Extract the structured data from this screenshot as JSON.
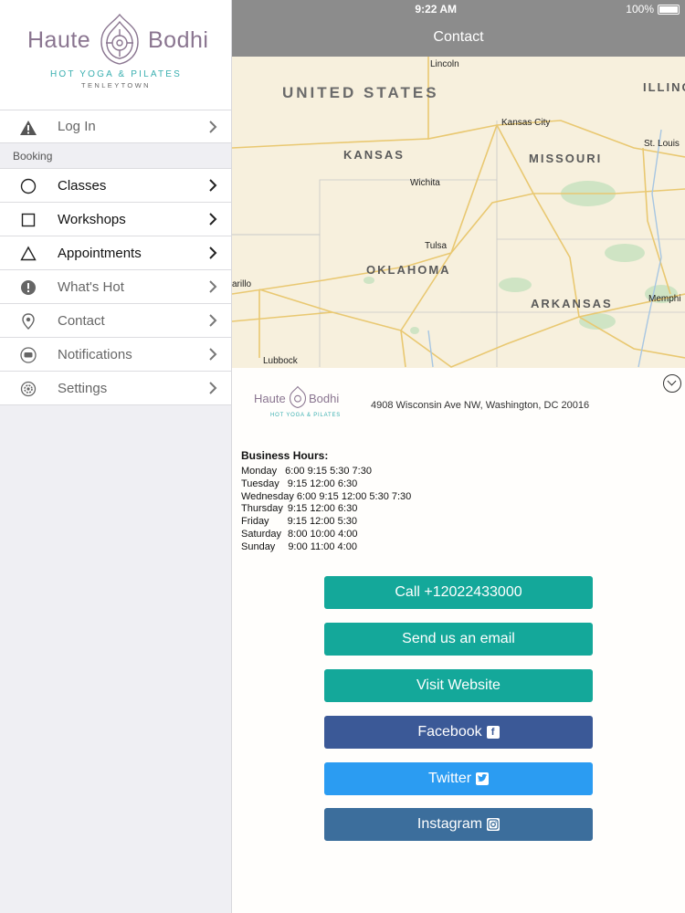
{
  "status_bar": {
    "time": "9:22 AM",
    "battery": "100%"
  },
  "nav": {
    "title": "Contact"
  },
  "logo": {
    "left_word": "Haute",
    "right_word": "Bodhi",
    "tagline": "HOT YOGA & PILATES",
    "location": "TENLEYTOWN"
  },
  "sidebar": {
    "login_label": "Log In",
    "section_label": "Booking",
    "items": [
      {
        "label": "Classes",
        "icon": "circle-icon"
      },
      {
        "label": "Workshops",
        "icon": "square-icon"
      },
      {
        "label": "Appointments",
        "icon": "triangle-icon"
      },
      {
        "label": "What's Hot",
        "icon": "exclamation-icon"
      },
      {
        "label": "Contact",
        "icon": "location-pin-icon"
      },
      {
        "label": "Notifications",
        "icon": "chat-bubble-icon"
      },
      {
        "label": "Settings",
        "icon": "gear-icon"
      }
    ]
  },
  "map": {
    "regions": [
      "UNITED STATES",
      "KANSAS",
      "MISSOURI",
      "OKLAHOMA",
      "ARKANSAS",
      "ILLING"
    ],
    "cities": [
      "Lincoln",
      "Kansas City",
      "St. Louis",
      "Wichita",
      "Tulsa",
      "arillo",
      "Memphi",
      "Lubbock"
    ]
  },
  "contact": {
    "address": "4908 Wisconsin Ave NW, Washington, DC  20016",
    "hours_title": "Business Hours:",
    "hours": [
      {
        "day": "Monday",
        "times": "6:00 9:15 5:30 7:30"
      },
      {
        "day": "Tuesday",
        "times": "9:15 12:00 6:30"
      },
      {
        "day": "Wednesday",
        "times": "6:00 9:15 12:00 5:30 7:30"
      },
      {
        "day": "Thursday",
        "times": "9:15 12:00 6:30"
      },
      {
        "day": "Friday",
        "times": "9:15 12:00 5:30"
      },
      {
        "day": "Saturday",
        "times": "8:00 10:00 4:00"
      },
      {
        "day": "Sunday",
        "times": "9:00 11:00 4:00"
      }
    ],
    "buttons": {
      "call": "Call +12022433000",
      "email": "Send us an email",
      "website": "Visit Website",
      "facebook": "Facebook",
      "twitter": "Twitter",
      "instagram": "Instagram"
    }
  },
  "colors": {
    "teal": "#14a89a",
    "facebook": "#3b5997",
    "twitter": "#2b9cf2",
    "instagram": "#3c6e9c",
    "header_gray": "#8c8c8c",
    "logo_purple": "#8a7590"
  }
}
